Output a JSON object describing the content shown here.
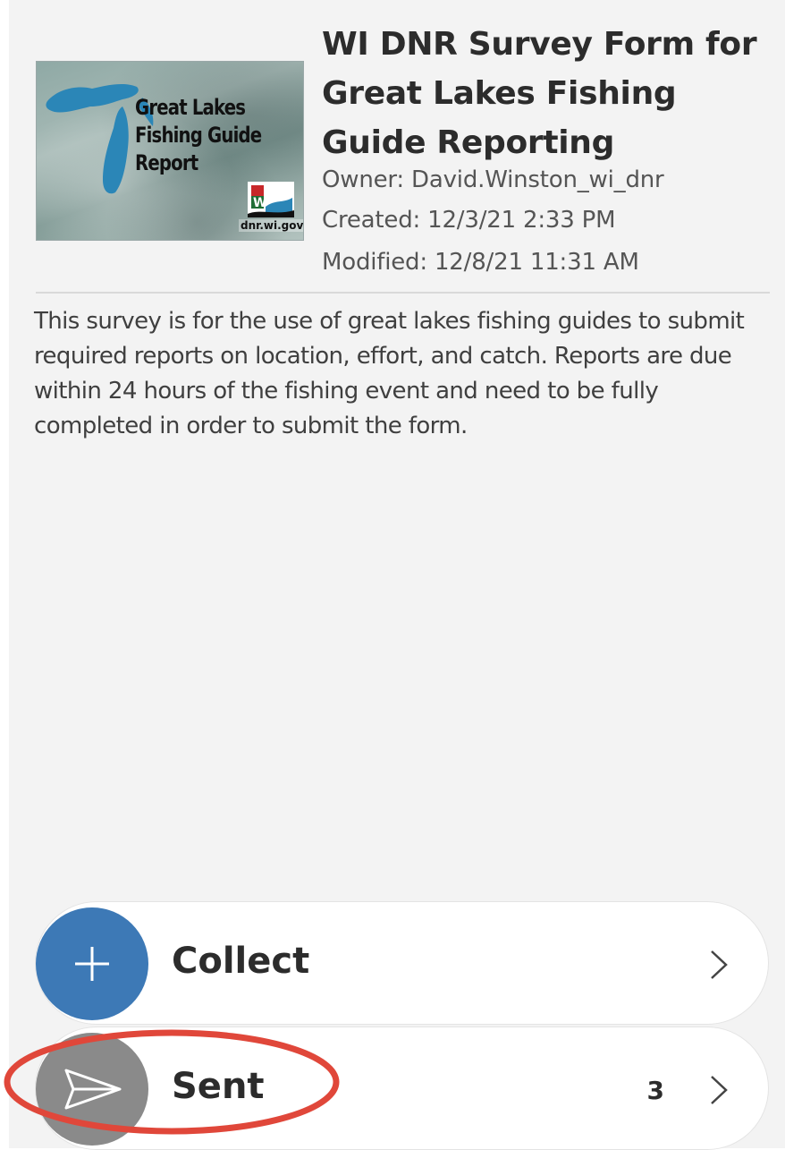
{
  "survey": {
    "title": "WI DNR Survey Form for\nGreat Lakes Fishing\nGuide Reporting",
    "owner": "Owner: David.Winston_wi_dnr",
    "created": "Created: 12/3/21 2:33 PM",
    "modified": "Modified: 12/8/21 11:31 AM",
    "description": "This survey is for the use of great lakes fishing guides to submit required reports on location, effort, and catch. Reports are due within 24 hours of the fishing event and need to be fully completed in order to submit the form."
  },
  "thumbnail": {
    "title_line1": "Great Lakes",
    "title_line2": "Fishing Guide",
    "title_line3": "Report",
    "url": "dnr.wi.gov",
    "logo_letter": "W"
  },
  "actions": {
    "collect": {
      "label": "Collect",
      "icon": "plus-icon",
      "color": "#3d79b6"
    },
    "sent": {
      "label": "Sent",
      "count": "3",
      "icon": "send-icon",
      "color": "#8a8a8a"
    }
  },
  "colors": {
    "background": "#f3f3f3",
    "highlight_ring": "#e0473a",
    "text_primary": "#2c2c2c",
    "text_secondary": "#555555"
  }
}
